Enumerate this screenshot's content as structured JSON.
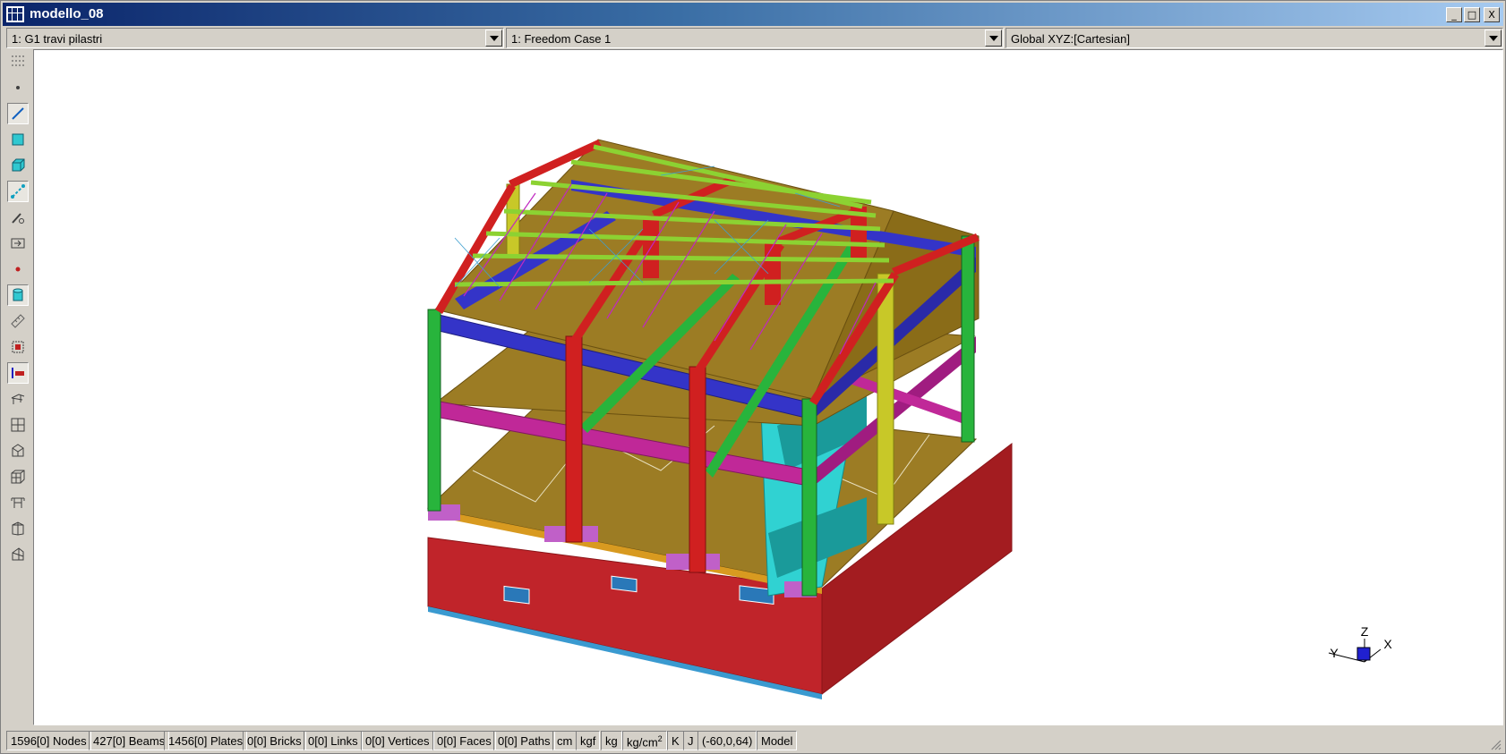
{
  "window": {
    "title": "modello_08",
    "minimize_label": "_",
    "maximize_label": "□",
    "close_label": "X"
  },
  "toolbar": {
    "group_select": "1: G1 travi pilastri",
    "freedom_case_select": "1: Freedom Case 1",
    "coordinate_system_select": "Global XYZ:[Cartesian]"
  },
  "left_tools": [
    "grid-dots-icon",
    "node-icon",
    "beam-icon",
    "plate-icon",
    "brick-icon",
    "link-icon",
    "path-icon",
    "export-icon",
    "point-icon",
    "cylinder-icon",
    "ruler-icon",
    "section-icon",
    "beam-property-icon",
    "stairs-icon",
    "mesh-icon",
    "extrude-icon",
    "cube-wire-icon",
    "frame-icon",
    "shell-icon",
    "surface-icon"
  ],
  "axis_triad": {
    "z": "Z",
    "x": "X",
    "y": "Y"
  },
  "statusbar": {
    "nodes": "1596[0] Nodes",
    "beams": "427[0] Beams",
    "plates": "1456[0] Plates",
    "bricks": "0[0] Bricks",
    "links": "0[0] Links",
    "vertices": "0[0] Vertices",
    "faces": "0[0] Faces",
    "paths": "0[0] Paths",
    "unit_length": "cm",
    "unit_force": "kgf",
    "unit_mass": "kg",
    "unit_stress": "kg/cm",
    "unit_stress_exp": "2",
    "unit_temp": "K",
    "unit_energy": "J",
    "coords": "(-60,0,64)",
    "mode": "Model"
  },
  "colors": {
    "title_start": "#0a246a",
    "title_end": "#a6caf0",
    "chrome": "#d4d0c8",
    "wall_red": "#c0242a",
    "slab_olive": "#9c7c24",
    "beam_blue": "#3434c8",
    "beam_magenta": "#c02898",
    "column_green": "#28b43c",
    "column_yellow": "#c8c828",
    "purlin_lime": "#8cd232",
    "stair_cyan": "#30d2d2"
  }
}
